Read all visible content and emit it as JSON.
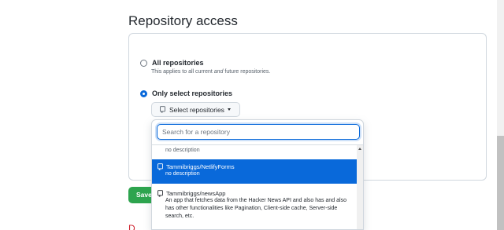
{
  "section": {
    "title": "Repository access"
  },
  "options": {
    "all": {
      "label": "All repositories",
      "note_prefix": "This applies to all current ",
      "note_em": "and",
      "note_suffix": " future repositories."
    },
    "only": {
      "label": "Only select repositories"
    }
  },
  "select_button": {
    "label": "Select repositories",
    "icon": "repo-icon"
  },
  "dropdown": {
    "search_placeholder": "Search for a repository",
    "partial_desc": "no description",
    "items": [
      {
        "name": "Tammibriggs/NetlifyForms",
        "desc": "no description",
        "selected": true
      },
      {
        "name": "Tammibriggs/newsApp",
        "desc": "An app that fetches data from the Hacker News API and also has and also has other functionalities like Pagination, Client-side cache, Server-side search, etc.",
        "selected": false
      }
    ]
  },
  "save_button": {
    "label": "Save"
  },
  "colors": {
    "accent": "#0969da",
    "save_green": "#2da44e",
    "danger": "#cf222e"
  }
}
